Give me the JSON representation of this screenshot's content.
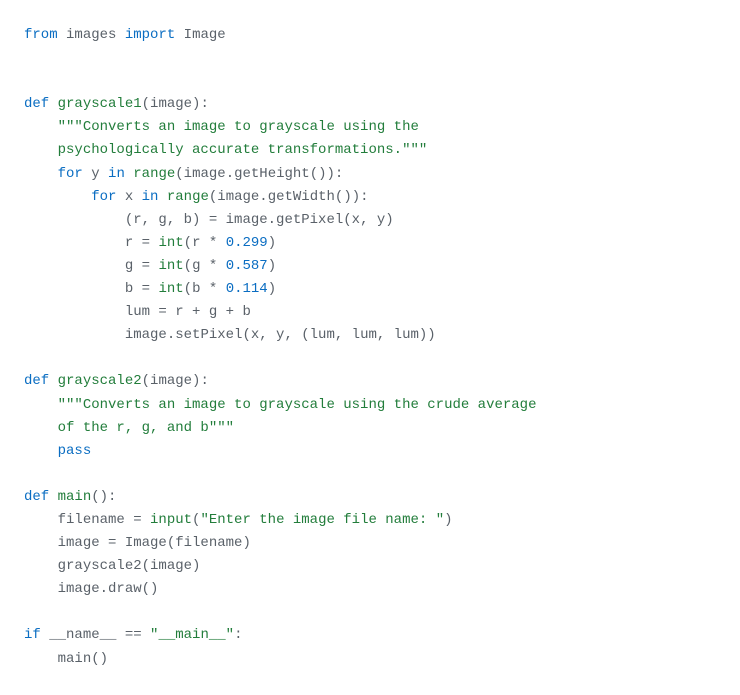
{
  "code": {
    "l1_from": "from",
    "l1_mod": "images",
    "l1_import": "import",
    "l1_cls": "Image",
    "l2_def": "def",
    "l2_fn": "grayscale1",
    "l2_param": "(image):",
    "l3_doc": "\"\"\"Converts an image to grayscale using the",
    "l4_doc": "psychologically accurate transformations.\"\"\"",
    "l5_for": "for",
    "l5_y": "y",
    "l5_in": "in",
    "l5_range": "range",
    "l5_rest": "(image.getHeight()):",
    "l6_for": "for",
    "l6_x": "x",
    "l6_in": "in",
    "l6_range": "range",
    "l6_rest": "(image.getWidth()):",
    "l7": "(r, g, b) = image.getPixel(x, y)",
    "l8_a": "r =",
    "l8_int": "int",
    "l8_b": "(r *",
    "l8_num": "0.299",
    "l8_c": ")",
    "l9_a": "g =",
    "l9_int": "int",
    "l9_b": "(g *",
    "l9_num": "0.587",
    "l9_c": ")",
    "l10_a": "b =",
    "l10_int": "int",
    "l10_b": "(b *",
    "l10_num": "0.114",
    "l10_c": ")",
    "l11": "lum = r + g + b",
    "l12": "image.setPixel(x, y, (lum, lum, lum))",
    "l13_def": "def",
    "l13_fn": "grayscale2",
    "l13_param": "(image):",
    "l14_doc": "\"\"\"Converts an image to grayscale using the crude average",
    "l15_doc": "of the r, g, and b\"\"\"",
    "l16_pass": "pass",
    "l17_def": "def",
    "l17_fn": "main",
    "l17_param": "():",
    "l18_a": "filename =",
    "l18_input": "input",
    "l18_b": "(",
    "l18_str": "\"Enter the image file name: \"",
    "l18_c": ")",
    "l19": "image = Image(filename)",
    "l20": "grayscale2(image)",
    "l21": "image.draw()",
    "l22_if": "if",
    "l22_name": "__name__ ==",
    "l22_str": "\"__main__\"",
    "l22_c": ":",
    "l23": "main()"
  }
}
